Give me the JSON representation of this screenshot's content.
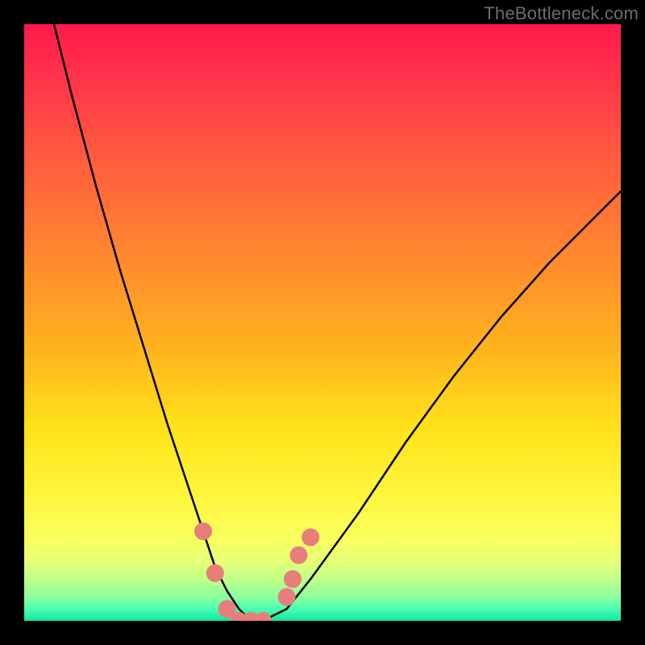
{
  "watermark": "TheBottleneck.com",
  "chart_data": {
    "type": "line",
    "title": "",
    "xlabel": "",
    "ylabel": "",
    "xlim": [
      0,
      100
    ],
    "ylim": [
      0,
      100
    ],
    "grid": false,
    "series": [
      {
        "name": "curve",
        "color": "#000000",
        "x": [
          5,
          8,
          12,
          16,
          20,
          24,
          28,
          30,
          32,
          34,
          36,
          38,
          40,
          44,
          48,
          56,
          64,
          72,
          80,
          88,
          96,
          100
        ],
        "y": [
          100,
          88,
          73,
          59,
          46,
          33,
          21,
          15,
          9,
          5,
          2,
          0,
          0,
          2,
          7,
          18,
          30,
          41,
          51,
          60,
          68,
          72
        ]
      },
      {
        "name": "markers",
        "type": "scatter",
        "color": "#e77e7c",
        "x": [
          30,
          32,
          34,
          36,
          38,
          40,
          44,
          45,
          46,
          48
        ],
        "y": [
          15,
          8,
          2,
          0,
          0,
          0,
          4,
          7,
          11,
          14
        ]
      }
    ],
    "notch_position_x": 37
  }
}
